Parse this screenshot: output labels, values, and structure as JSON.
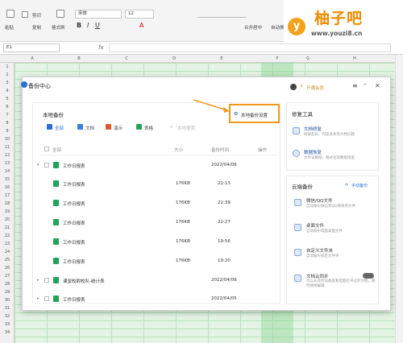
{
  "ribbon": {
    "paste": "粘贴",
    "cut": "剪切",
    "copy": "复制",
    "format_painter": "格式刷",
    "font_name": "宋体",
    "font_size": "12",
    "merge_center": "合并居中",
    "auto_wrap": "自动换行",
    "tab_label": "常用"
  },
  "watermark": {
    "brand": "柚子吧",
    "badge": "y",
    "url": "www.youzi8.cn"
  },
  "formula_bar": {
    "cell_ref": "E1",
    "fx": "fx"
  },
  "sheet": {
    "columns": [
      "A",
      "B",
      "C",
      "D",
      "E",
      "F",
      "G",
      "H"
    ],
    "rows": [
      "1",
      "2",
      "3",
      "4",
      "5",
      "6",
      "7",
      "8",
      "9",
      "10",
      "11",
      "12",
      "13",
      "14",
      "15",
      "16",
      "17",
      "18",
      "19",
      "20",
      "21",
      "22",
      "23",
      "24",
      "25",
      "26",
      "27",
      "28",
      "29",
      "30",
      "31",
      "32",
      "33",
      "34"
    ]
  },
  "dialog": {
    "title": "备份中心",
    "open_member": "开通会员",
    "local_backup": {
      "title": "本地备份",
      "settings_link": "本地备份设置",
      "filters": [
        "全部",
        "文档",
        "演示",
        "表格"
      ],
      "search_placeholder": "本地搜索",
      "headers": {
        "all": "全部",
        "size": "大小",
        "time": "备份时间",
        "op": "操作"
      },
      "groups": [
        {
          "name": "工作日报表",
          "date": "2022/04/06",
          "files": [
            {
              "name": "工作日报表",
              "size": "176KB",
              "time": "22:13"
            },
            {
              "name": "工作日报表",
              "size": "176KB",
              "time": "22:39"
            },
            {
              "name": "工作日报表",
              "size": "176KB",
              "time": "22:27"
            },
            {
              "name": "工作日报表",
              "size": "176KB",
              "time": "19:56"
            },
            {
              "name": "工作日报表",
              "size": "176KB",
              "time": "19:20"
            }
          ]
        },
        {
          "name": "课堂校尉校队-统计表",
          "date": "2022/04/06"
        },
        {
          "name": "工作日报表",
          "date": "2022/04/05"
        }
      ]
    },
    "repair_tools": {
      "title": "修复工具",
      "items": [
        {
          "name": "文档修复",
          "desc": "修复乱码、内容丢失等文档问题"
        },
        {
          "name": "数据恢复",
          "desc": "文件误删除、格式化等数据恢复"
        }
      ]
    },
    "cloud_backup": {
      "title": "云端备份",
      "manual": "手动备份",
      "items": [
        {
          "name": "微信/QQ文件",
          "desc": "自动备份微信和QQ接收的文件"
        },
        {
          "name": "桌面文件",
          "desc": "自动备份电脑桌面文件"
        },
        {
          "name": "自定义文件夹",
          "desc": "自动备份指定文件夹"
        },
        {
          "name": "文档云同步",
          "desc": "可以从其他设备查看电脑打开过的文档，随时随地编辑"
        }
      ]
    }
  }
}
